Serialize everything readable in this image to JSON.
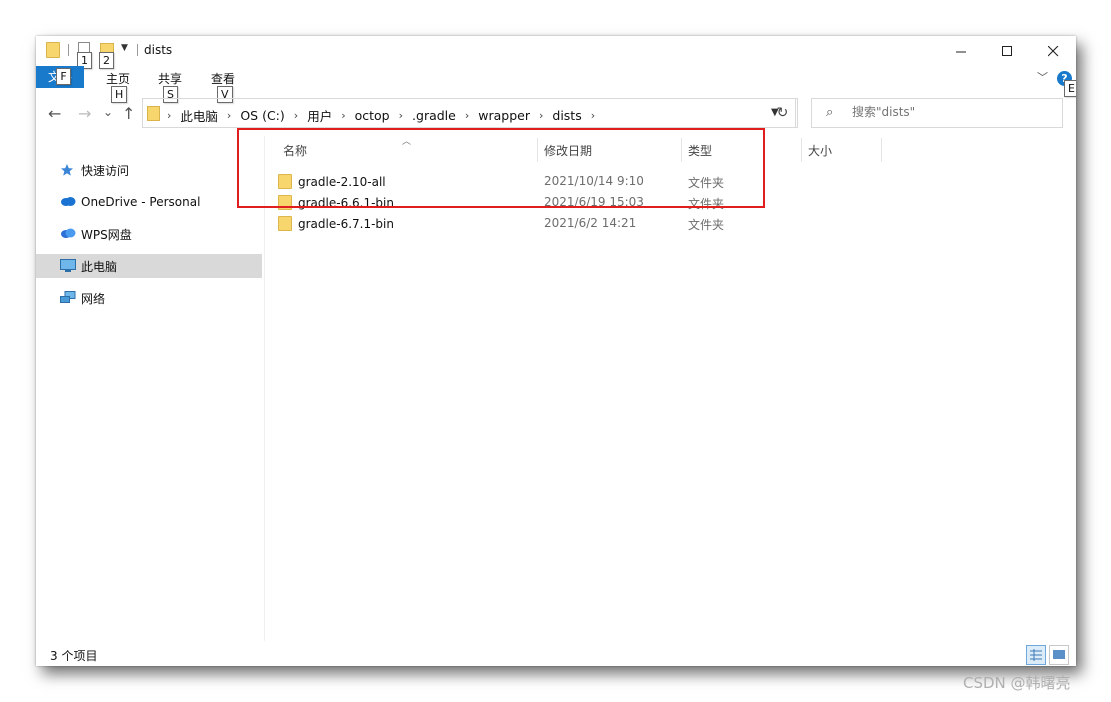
{
  "window": {
    "title": "dists",
    "keytips_quick": [
      "1",
      "2"
    ],
    "controls": {
      "minimize": "—",
      "maximize": "☐",
      "close": "✕"
    }
  },
  "ribbon": {
    "file_tab": "文件",
    "file_keytip": "F",
    "tabs": [
      {
        "label": "主页",
        "keytip": "H"
      },
      {
        "label": "共享",
        "keytip": "S"
      },
      {
        "label": "查看",
        "keytip": "V"
      }
    ],
    "help_label": "?",
    "help_keytip": "E"
  },
  "nav": {
    "back": "←",
    "forward": "→",
    "recent": "⌄",
    "up": "↑"
  },
  "breadcrumb": [
    "此电脑",
    "OS (C:)",
    "用户",
    "octop",
    ".gradle",
    "wrapper",
    "dists"
  ],
  "search": {
    "placeholder": "搜索\"dists\""
  },
  "sidebar": {
    "items": [
      {
        "label": "快速访问",
        "icon": "star-icon"
      },
      {
        "label": "OneDrive - Personal",
        "icon": "cloud-icon"
      },
      {
        "label": "WPS网盘",
        "icon": "wps-cloud-icon"
      },
      {
        "label": "此电脑",
        "icon": "computer-icon",
        "selected": true
      },
      {
        "label": "网络",
        "icon": "network-icon"
      }
    ]
  },
  "columns": {
    "name": "名称",
    "modified": "修改日期",
    "type": "类型",
    "size": "大小"
  },
  "files": [
    {
      "name": "gradle-2.10-all",
      "modified": "2021/10/14 9:10",
      "type": "文件夹"
    },
    {
      "name": "gradle-6.6.1-bin",
      "modified": "2021/6/19 15:03",
      "type": "文件夹"
    },
    {
      "name": "gradle-6.7.1-bin",
      "modified": "2021/6/2 14:21",
      "type": "文件夹"
    }
  ],
  "status": {
    "item_count": "3 个项目"
  },
  "watermark": "CSDN @韩曙亮",
  "colors": {
    "accent": "#1979ca",
    "highlight_box": "#e01e1e",
    "folder": "#f6d66d",
    "selected_nav": "#d9d9d9"
  }
}
